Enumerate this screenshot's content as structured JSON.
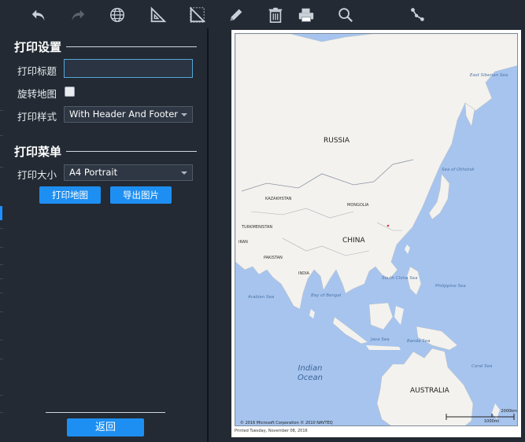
{
  "toolbar": {
    "icons": [
      "undo-icon",
      "redo-icon",
      "globe-icon",
      "measure-triangle-icon",
      "measure-area-icon",
      "pencil-icon",
      "trash-icon",
      "printer-icon",
      "search-icon",
      "route-icon"
    ]
  },
  "print_settings": {
    "section_title": "打印设置",
    "title_label": "打印标题",
    "title_value": "",
    "rotate_label": "旋转地图",
    "rotate_checked": false,
    "style_label": "打印样式",
    "style_value": "With Header And Footer"
  },
  "print_menu": {
    "section_title": "打印菜单",
    "size_label": "打印大小",
    "size_value": "A4 Portrait",
    "print_button": "打印地图",
    "export_button": "导出图片"
  },
  "back_button": "返回",
  "map": {
    "labels": {
      "russia": "RUSSIA",
      "china": "CHINA",
      "australia": "AUSTRALIA",
      "kazakhstan": "KAZAKHSTAN",
      "mongolia": "MONGOLIA",
      "india": "INDIA",
      "turkmenistan": "TURKMENISTAN",
      "iran": "IRAN",
      "pakistan": "PAKISTAN"
    },
    "seas": {
      "east_siberian": "East Siberian Sea",
      "okhotsk": "Sea of Okhotsk",
      "south_china": "South China Sea",
      "philippine": "Philippine Sea",
      "arabian": "Arabian Sea",
      "bengal": "Bay of Bengal",
      "java": "Java Sea",
      "banda": "Banda Sea",
      "coral": "Coral Sea"
    },
    "ocean": "Indian Ocean",
    "copyright": "© 2016 Microsoft Corporation © 2010 NAVTEQ",
    "scale_top": "2000km",
    "scale_bottom": "1000mi",
    "printed": "Printed Tuesday, November 08, 2016"
  },
  "colors": {
    "accent": "#1e8ff2",
    "background": "#232a33",
    "water": "#a6c4ee",
    "land": "#f4f2ee"
  }
}
